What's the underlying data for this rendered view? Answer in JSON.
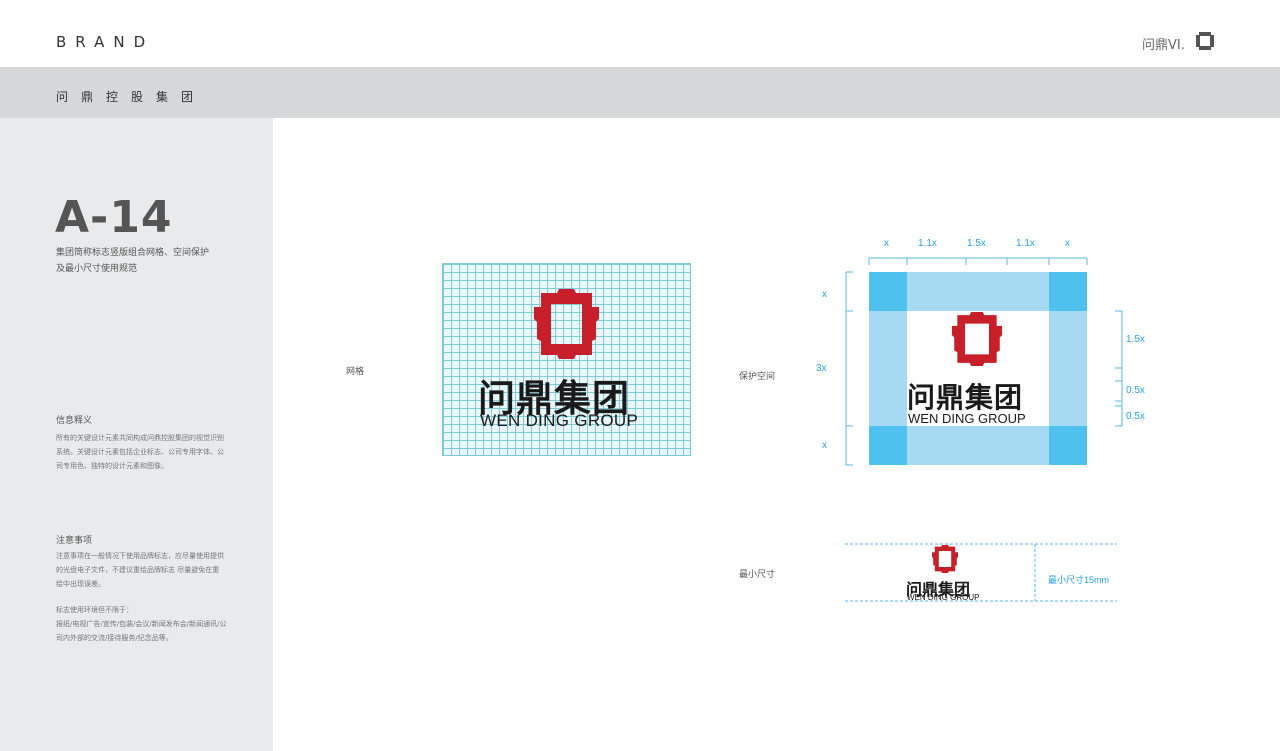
{
  "header": {
    "brand": "BRAND",
    "vi_label": "问鼎VI."
  },
  "band": {
    "company": "问鼎控股集团"
  },
  "sidebar": {
    "page_number": "A-14",
    "subtitle_line1": "集团简称标志竖版组合网格、空间保护",
    "subtitle_line2": "及最小尺寸使用规范",
    "info_title": "信息释义",
    "info_lines": [
      "所有的关键设计元素共同构成问鼎控股集团的视觉识别",
      "系统。关键设计元素包括企业标志、公司专用字体、公",
      "司专用色、独特的设计元素和图像。"
    ],
    "notes_title": "注意事项",
    "notes_lines": [
      "注意事项在一般情况下使用品牌标志，应尽量使用提供",
      "的光盘电子文件，不建议重绘品牌标志   尽量避免在重",
      "绘中出现误差。"
    ],
    "usage_lines": [
      "标志使用环境但不限于：",
      "报纸/电视广告/宣传/包装/会议/新闻发布会/新闻通讯/公",
      "司内外部的交流/接待服务/纪念品等。"
    ]
  },
  "sections": {
    "grid_label": "网格",
    "protect_label": "保护空间",
    "min_label": "最小尺寸",
    "min_size_text": "最小尺寸15mm"
  },
  "logo": {
    "cn": "问鼎集团",
    "en": "WEN DING GROUP"
  },
  "dimensions": {
    "top": [
      "x",
      "1.1x",
      "1.5x",
      "1.1x",
      "x"
    ],
    "left": [
      "x",
      "3x",
      "x"
    ],
    "right": [
      "1.5x",
      "0.5x",
      "0.5x"
    ]
  },
  "colors": {
    "logo_red": "#c8202a",
    "protect_light": "#a6d9f2",
    "protect_corner": "#4fc1ee",
    "dim_blue": "#2aa3e0"
  }
}
